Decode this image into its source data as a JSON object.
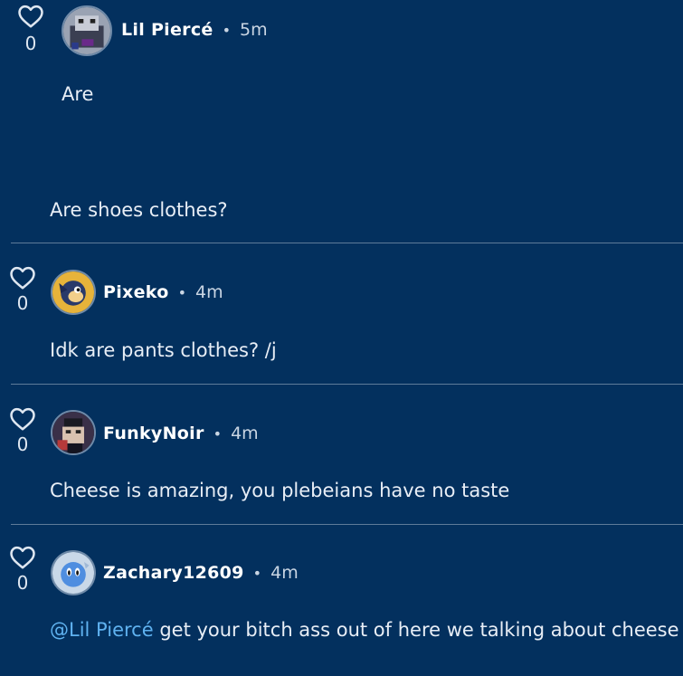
{
  "colors": {
    "background": "#03305e",
    "text": "#e8eef6",
    "mention": "#5fb2f0",
    "divider": "#5f7b99"
  },
  "comments": [
    {
      "like_icon": "heart-outline-icon",
      "likes": "0",
      "username": "Lil Piercé",
      "separator": "•",
      "time": "5m",
      "quote": "Are",
      "text": "Are shoes clothes?"
    },
    {
      "like_icon": "heart-outline-icon",
      "likes": "0",
      "username": "Pixeko",
      "separator": "•",
      "time": "4m",
      "text": "Idk are pants clothes? /j"
    },
    {
      "like_icon": "heart-outline-icon",
      "likes": "0",
      "username": "FunkyNoir",
      "separator": "•",
      "time": "4m",
      "text": "Cheese is amazing, you plebeians have no taste"
    },
    {
      "like_icon": "heart-outline-icon",
      "likes": "0",
      "username": "Zachary12609",
      "separator": "•",
      "time": "4m",
      "mention": "@Lil Piercé",
      "text": " get your bitch ass out of here we talking about cheese /j"
    }
  ]
}
